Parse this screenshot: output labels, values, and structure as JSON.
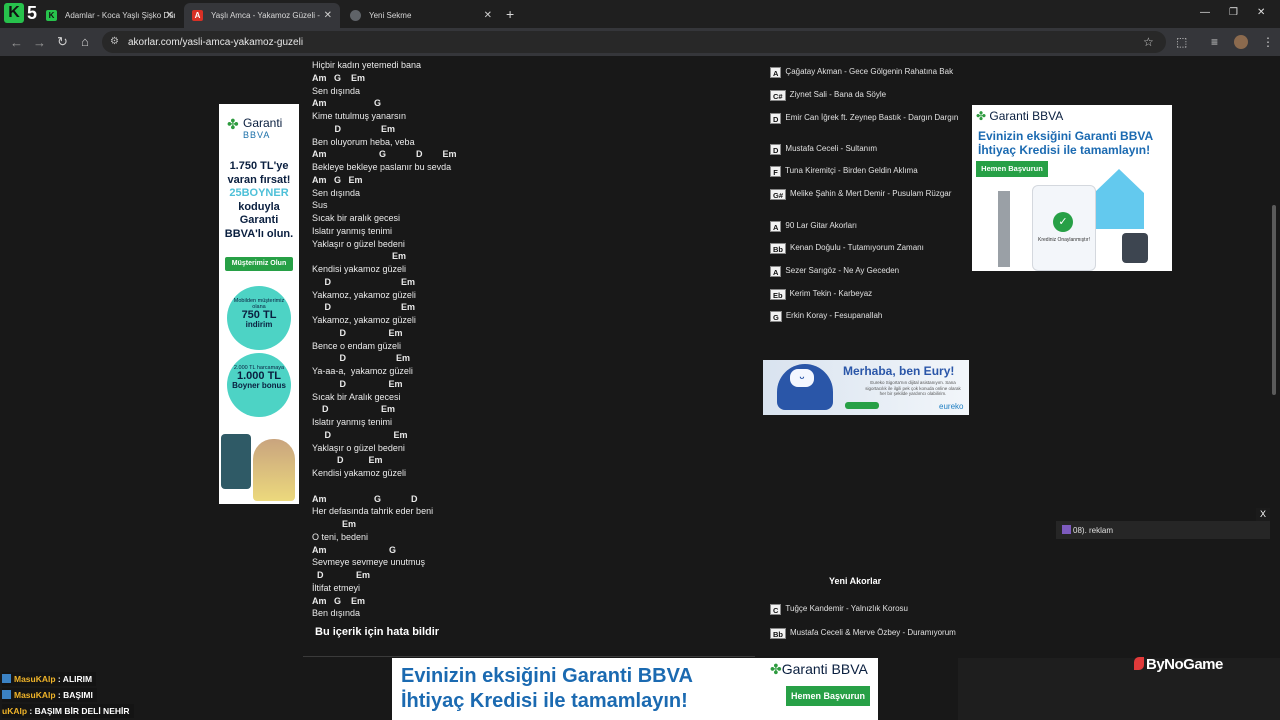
{
  "browser": {
    "tabs": [
      {
        "title": "Adamlar - Koca Yaşlı Şişko Dünya"
      },
      {
        "title": "Yaşlı Amca - Yakamoz Güzeli - Akor"
      },
      {
        "title": "Yeni Sekme"
      }
    ],
    "url": "akorlar.com/yasli-amca-yakamoz-guzeli",
    "brand_k": "K",
    "brand_5": "5"
  },
  "lyrics": [
    {
      "t": "Hiçbir kadın yetemedi bana",
      "c": false
    },
    {
      "t": "Am   G    Em",
      "c": true
    },
    {
      "t": "Sen dışında",
      "c": false
    },
    {
      "t": "Am                   G",
      "c": true
    },
    {
      "t": "Kime tutulmuş yanarsın",
      "c": false
    },
    {
      "t": "         D                Em",
      "c": true
    },
    {
      "t": "Ben oluyorum heba, veba",
      "c": false
    },
    {
      "t": "Am                     G            D        Em",
      "c": true
    },
    {
      "t": "Bekleye bekleye paslanır bu sevda",
      "c": false
    },
    {
      "t": "Am   G   Em",
      "c": true
    },
    {
      "t": "Sen dışında",
      "c": false
    },
    {
      "t": "Sus",
      "c": false
    },
    {
      "t": "Sıcak bir aralık gecesi",
      "c": false
    },
    {
      "t": "Islatır yanmış tenimi",
      "c": false
    },
    {
      "t": "Yaklaşır o güzel bedeni",
      "c": false
    },
    {
      "t": "                                Em",
      "c": true
    },
    {
      "t": "Kendisi yakamoz güzeli",
      "c": false
    },
    {
      "t": "     D                            Em",
      "c": true
    },
    {
      "t": "Yakamoz, yakamoz güzeli",
      "c": false
    },
    {
      "t": "     D                            Em",
      "c": true
    },
    {
      "t": "Yakamoz, yakamoz güzeli",
      "c": false
    },
    {
      "t": "           D                 Em",
      "c": true
    },
    {
      "t": "Bence o endam güzeli",
      "c": false
    },
    {
      "t": "           D                    Em",
      "c": true
    },
    {
      "t": "Ya-aa-a,  yakamoz güzeli",
      "c": false
    },
    {
      "t": "           D                 Em",
      "c": true
    },
    {
      "t": "Sıcak bir Aralık gecesi",
      "c": false
    },
    {
      "t": "    D                     Em",
      "c": true
    },
    {
      "t": "Islatır yanmış tenimi",
      "c": false
    },
    {
      "t": "     D                         Em",
      "c": true
    },
    {
      "t": "Yaklaşır o güzel bedeni",
      "c": false
    },
    {
      "t": "          D          Em",
      "c": true
    },
    {
      "t": "Kendisi yakamoz güzeli",
      "c": false
    },
    {
      "t": "",
      "c": false
    },
    {
      "t": "Am                   G            D",
      "c": true
    },
    {
      "t": "Her defasında tahrik eder beni",
      "c": false
    },
    {
      "t": "            Em",
      "c": true
    },
    {
      "t": "O teni, bedeni",
      "c": false
    },
    {
      "t": "Am                         G",
      "c": true
    },
    {
      "t": "Sevmeye sevmeye unutmuş",
      "c": false
    },
    {
      "t": "  D             Em",
      "c": true
    },
    {
      "t": "İltifat etmeyi",
      "c": false
    },
    {
      "t": "Am   G    Em",
      "c": true
    },
    {
      "t": "Ben dışında",
      "c": false
    }
  ],
  "report_label": "Bu içerik için hata bildir",
  "related_songs": [
    {
      "key": "A",
      "name": "Çağatay Akman - Gece Gölgenin Rahatına Bak"
    },
    {
      "key": "C#",
      "name": "Ziynet Sali - Bana da Söyle"
    },
    {
      "key": "D",
      "name": "Emir Can İğrek ft. Zeynep Bastık - Dargın Dargın"
    },
    {
      "key": "D",
      "name": "Mustafa Ceceli - Sultanım"
    },
    {
      "key": "F",
      "name": "Tuna Kiremitçi - Birden Geldin Aklıma"
    },
    {
      "key": "G#",
      "name": "Melike Şahin & Mert Demir - Pusulam Rüzgar"
    },
    {
      "key": "A",
      "name": "90 Lar Gitar Akorları"
    },
    {
      "key": "Bb",
      "name": "Kenan Doğulu - Tutamıyorum Zamanı"
    },
    {
      "key": "A",
      "name": "Sezer Sarıgöz - Ne Ay Geceden"
    },
    {
      "key": "Eb",
      "name": "Kerim Tekin - Karbeyaz"
    },
    {
      "key": "G",
      "name": "Erkin Koray - Fesupanallah"
    }
  ],
  "new_chords_heading": "Yeni Akorlar",
  "new_songs": [
    {
      "key": "C",
      "name": "Tuğçe Kandemir - Yalnızlık Korosu"
    },
    {
      "key": "Bb",
      "name": "Mustafa Ceceli & Merve Özbey - Duramıyorum"
    }
  ],
  "ads": {
    "left": {
      "logo_1": "Garanti",
      "logo_2": "BBVA",
      "promo_1": "1.750 TL'ye varan fırsat!",
      "promo_code": "25BOYNER",
      "promo_2": "koduyla Garanti BBVA'lı olun.",
      "button": "Müşterimiz Olun",
      "circle1_small": "Mobilden müşterimiz olana",
      "circle1_big": "750 TL",
      "circle1_bottom": "indirim",
      "circle2_small": "2.000 TL harcamaya",
      "circle2_big": "1.000 TL",
      "circle2_bottom": "Boyner bonus"
    },
    "right": {
      "logo": "Garanti BBVA",
      "headline": "Evinizin eksiğini Garanti BBVA İhtiyaç Kredisi ile tamamlayın!",
      "button": "Hemen Başvurun",
      "caption": "Krediniz Onaylanmıştır!"
    },
    "eury": {
      "headline": "Merhaba, ben Eury!",
      "body": "Eureko Sigorta'nın dijital asistanıyım. Sana sigortacılık ile ilgili pek çok konuda online olarak her bir şekilde yardımcı olabilirim.",
      "brand": "eureko"
    },
    "bottom": {
      "headline_1": "Evinizin eksiğini Garanti BBVA",
      "headline_2": "İhtiyaç Kredisi ile tamamlayın!",
      "logo": "Garanti BBVA",
      "button": "Hemen Başvurun"
    }
  },
  "overlay": {
    "chat": [
      {
        "user": "MasuKAlp",
        "msg": " : ALIRIM"
      },
      {
        "user": "MasuKAlp",
        "msg": " : BAŞIMI"
      },
      {
        "user": "uKAlp",
        "msg": " : BAŞIM BİR DELİ NEHİR"
      }
    ],
    "bynogame": "ByNoGame",
    "widget_text": "08). reklam",
    "widget_close": "X"
  }
}
